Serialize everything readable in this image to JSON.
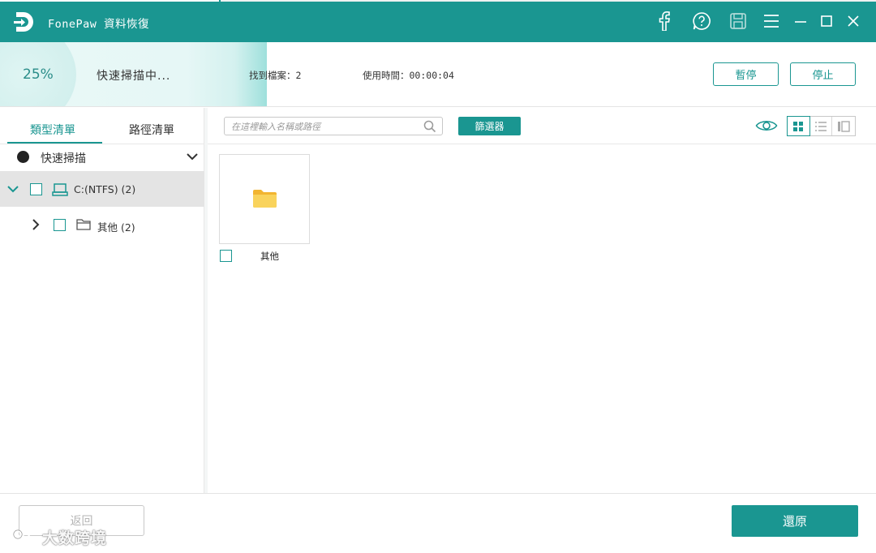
{
  "window": {
    "title": "FonePaw 資料恢復",
    "controls": [
      "facebook-icon",
      "help-icon",
      "save-icon",
      "menu-icon",
      "minimize-icon",
      "maximize-icon",
      "close-icon"
    ]
  },
  "scan": {
    "percent": "25%",
    "progress": 0.25,
    "status": "快速掃描中...",
    "files_found": "找到檔案：2",
    "elapsed": "使用時間：00:00:04",
    "pause_label": "暫停",
    "stop_label": "停止"
  },
  "sidebar": {
    "tabs": [
      {
        "label": "類型清單",
        "active": true
      },
      {
        "label": "路徑清單",
        "active": false
      }
    ],
    "quick_scan_label": "快速掃描",
    "tree": [
      {
        "label": "C:(NTFS) (2)",
        "icon": "drive-icon",
        "expanded": true,
        "selected": true
      },
      {
        "label": "其他 (2)",
        "icon": "folder-outline-icon",
        "expanded": false,
        "selected": false
      }
    ]
  },
  "toolbar": {
    "search_placeholder": "在這裡輸入名稱或路徑",
    "filter_label": "篩選器",
    "view_modes": [
      "grid-view-icon",
      "list-view-icon",
      "detail-view-icon"
    ],
    "active_view": "grid"
  },
  "files": [
    {
      "name": "其他",
      "icon": "folder-icon"
    }
  ],
  "footer": {
    "back_label": "返回",
    "restore_label": "還原",
    "watermark": "大数跨境"
  },
  "colors": {
    "accent": "#1a9691",
    "selected_row": "#e4e4e4",
    "folder": "#f7c948"
  }
}
